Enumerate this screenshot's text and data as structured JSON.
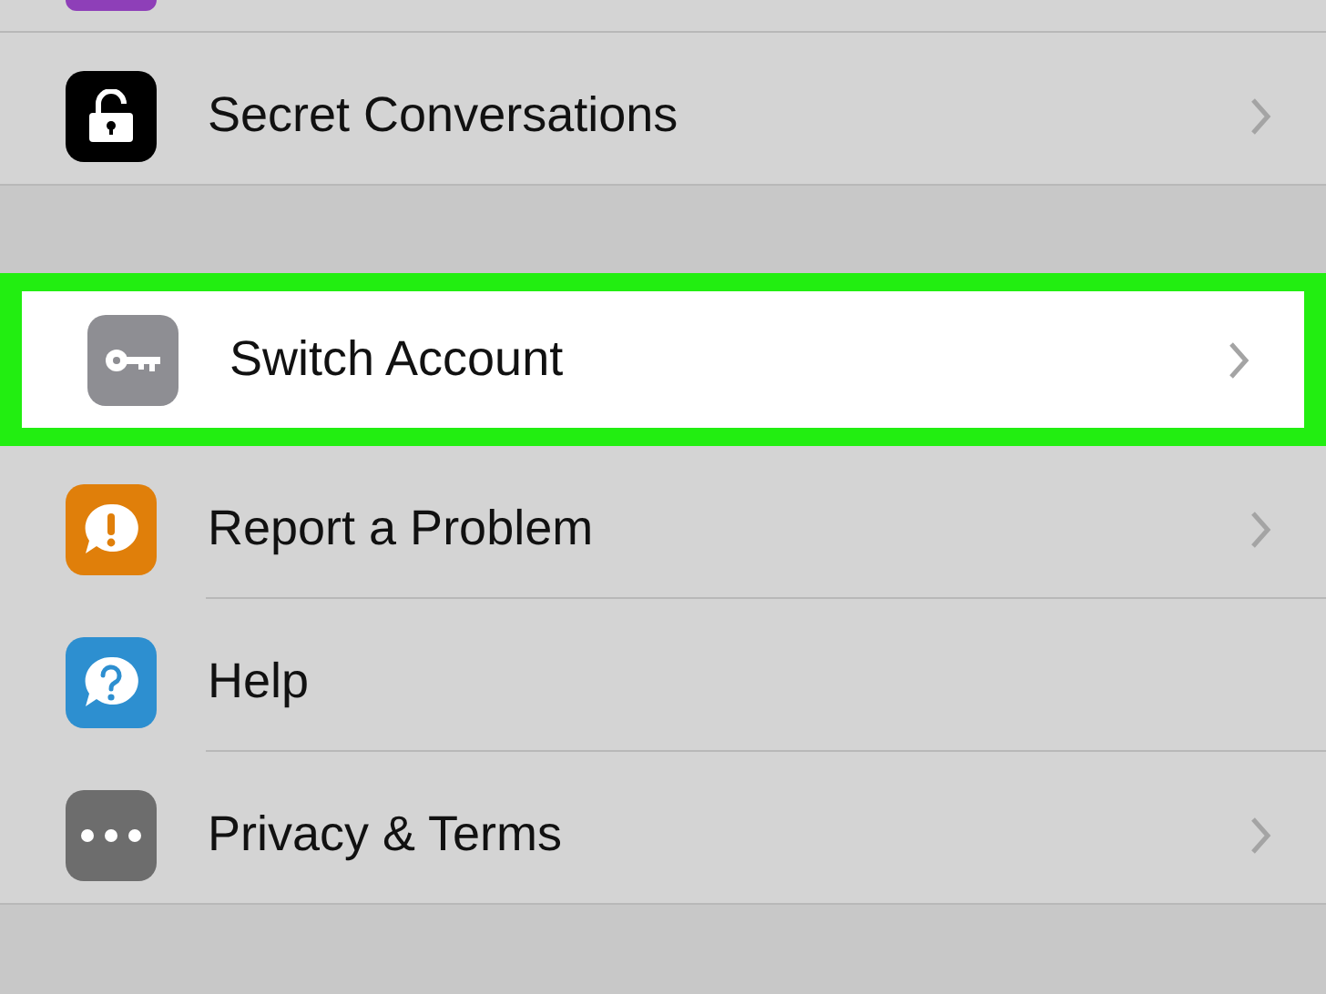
{
  "top_row": {
    "color": "#8e3fb8"
  },
  "sections": [
    {
      "rows": [
        {
          "kind": "lock",
          "color": "#000000",
          "label": "Secret Conversations",
          "chevron": true,
          "highlighted": false
        }
      ]
    },
    {
      "rows": [
        {
          "kind": "key",
          "color": "#8e8e93",
          "label": "Switch Account",
          "chevron": true,
          "highlighted": true
        },
        {
          "kind": "alert",
          "color": "#e07f0a",
          "label": "Report a Problem",
          "chevron": true,
          "highlighted": false
        },
        {
          "kind": "question",
          "color": "#2d8fd0",
          "label": "Help",
          "chevron": false,
          "highlighted": false
        },
        {
          "kind": "dots",
          "color": "#6d6d6d",
          "label": "Privacy & Terms",
          "chevron": true,
          "highlighted": false
        }
      ]
    }
  ]
}
